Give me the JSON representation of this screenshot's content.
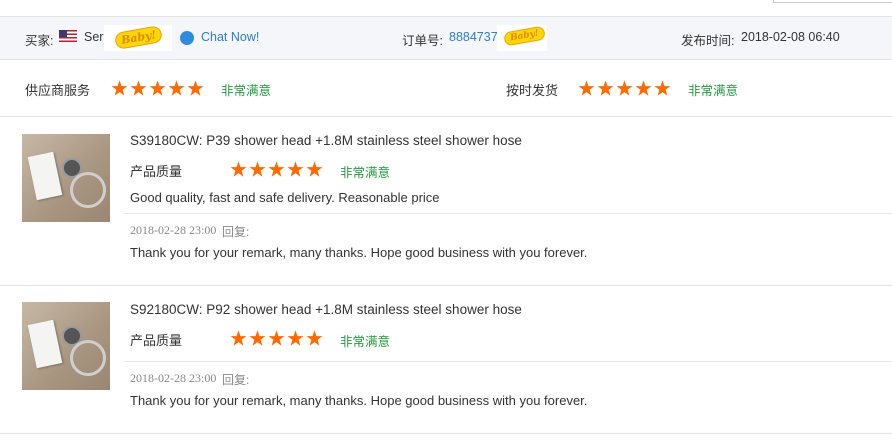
{
  "header": {
    "buyer_label": "买家:",
    "buyer_name": "Ser",
    "chat_label": "Chat Now!",
    "order_label": "订单号:",
    "order_number": "8884737",
    "published_label": "发布时间:",
    "published_time": "2018-02-08 06:40",
    "logo_text": "Baby!"
  },
  "seller_ratings": {
    "service_label": "供应商服务",
    "service_stars": 5,
    "service_rating": "非常满意",
    "shipping_label": "按时发货",
    "shipping_stars": 5,
    "shipping_rating": "非常满意"
  },
  "reviews": [
    {
      "product": "S39180CW: P39 shower head +1.8M stainless steel shower hose",
      "quality_label": "产品质量",
      "stars": 5,
      "rating": "非常满意",
      "comment": "Good quality, fast and safe delivery. Reasonable price",
      "reply_date": "2018-02-28 23:00",
      "reply_label": "回复:",
      "reply_text": "Thank you for your remark, many thanks. Hope good business with you forever."
    },
    {
      "product": "S92180CW: P92 shower head +1.8M stainless steel shower hose",
      "quality_label": "产品质量",
      "stars": 5,
      "rating": "非常满意",
      "reply_date": "2018-02-28 23:00",
      "reply_label": "回复:",
      "reply_text": "Thank you for your remark, many thanks. Hope good business with you forever."
    }
  ],
  "colors": {
    "star": "#ff6a00",
    "satisfied": "#229a3c",
    "link": "#2d7fc2",
    "header_bg": "#f4f6f9"
  }
}
